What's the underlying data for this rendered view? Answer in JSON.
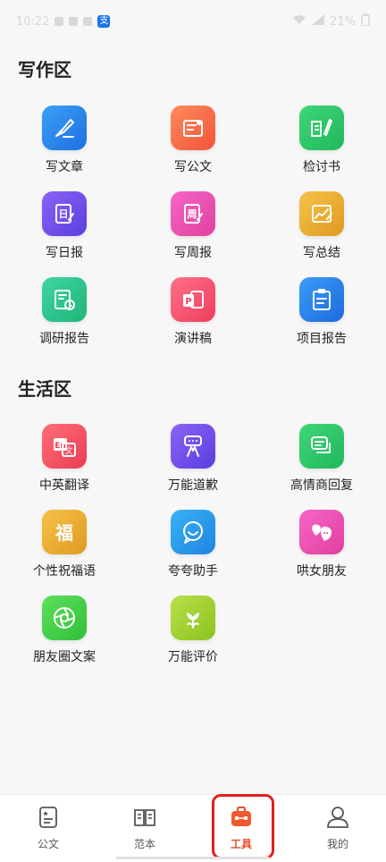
{
  "status_bar": {
    "time": "10:22",
    "battery": "21%"
  },
  "sections": [
    {
      "title": "写作区",
      "items": [
        {
          "label": "写文章",
          "icon": "pen-nib-icon",
          "color_from": "#3aa0f5",
          "color_to": "#1f6fe0"
        },
        {
          "label": "写公文",
          "icon": "document-stamp-icon",
          "color_from": "#ff8a5c",
          "color_to": "#f2553a"
        },
        {
          "label": "检讨书",
          "icon": "book-pencil-icon",
          "color_from": "#3fd67a",
          "color_to": "#1fb85a"
        },
        {
          "label": "写日报",
          "icon": "daily-report-icon",
          "color_from": "#8a63f5",
          "color_to": "#5b3ee0"
        },
        {
          "label": "写周报",
          "icon": "weekly-report-icon",
          "color_from": "#f566c8",
          "color_to": "#e0409e"
        },
        {
          "label": "写总结",
          "icon": "summary-chart-icon",
          "color_from": "#f5c24a",
          "color_to": "#e09a1f"
        },
        {
          "label": "调研报告",
          "icon": "research-clock-icon",
          "color_from": "#3ed6a0",
          "color_to": "#1fb57a"
        },
        {
          "label": "演讲稿",
          "icon": "presentation-icon",
          "color_from": "#ff7088",
          "color_to": "#ee3f5e"
        },
        {
          "label": "项目报告",
          "icon": "clipboard-icon",
          "color_from": "#3a9cf5",
          "color_to": "#1f6ae0"
        }
      ]
    },
    {
      "title": "生活区",
      "items": [
        {
          "label": "中英翻译",
          "icon": "translate-icon",
          "color_from": "#ff6e7a",
          "color_to": "#ea3d52"
        },
        {
          "label": "万能道歉",
          "icon": "apology-hands-icon",
          "color_from": "#8a63f5",
          "color_to": "#5b3ee0"
        },
        {
          "label": "高情商回复",
          "icon": "chat-bubbles-icon",
          "color_from": "#3fd67a",
          "color_to": "#1fb85a"
        },
        {
          "label": "个性祝福语",
          "icon": "fu-blessing-icon",
          "color_from": "#f5c24a",
          "color_to": "#e09a1f"
        },
        {
          "label": "夸夸助手",
          "icon": "smile-bubble-icon",
          "color_from": "#3ab2f5",
          "color_to": "#1f84e0"
        },
        {
          "label": "哄女朋友",
          "icon": "heart-chat-icon",
          "color_from": "#f566c8",
          "color_to": "#e0409e"
        },
        {
          "label": "朋友圈文案",
          "icon": "moments-shutter-icon",
          "color_from": "#5ee05a",
          "color_to": "#2fc03a"
        },
        {
          "label": "万能评价",
          "icon": "flower-icon",
          "color_from": "#b8e04a",
          "color_to": "#8cc21f"
        }
      ]
    }
  ],
  "tab_bar": {
    "tabs": [
      {
        "label": "公文",
        "icon": "document-star-icon"
      },
      {
        "label": "范本",
        "icon": "open-book-icon"
      },
      {
        "label": "工具",
        "icon": "toolbox-icon",
        "active": true
      },
      {
        "label": "我的",
        "icon": "person-icon"
      }
    ],
    "active_color": "#e84a2a"
  }
}
